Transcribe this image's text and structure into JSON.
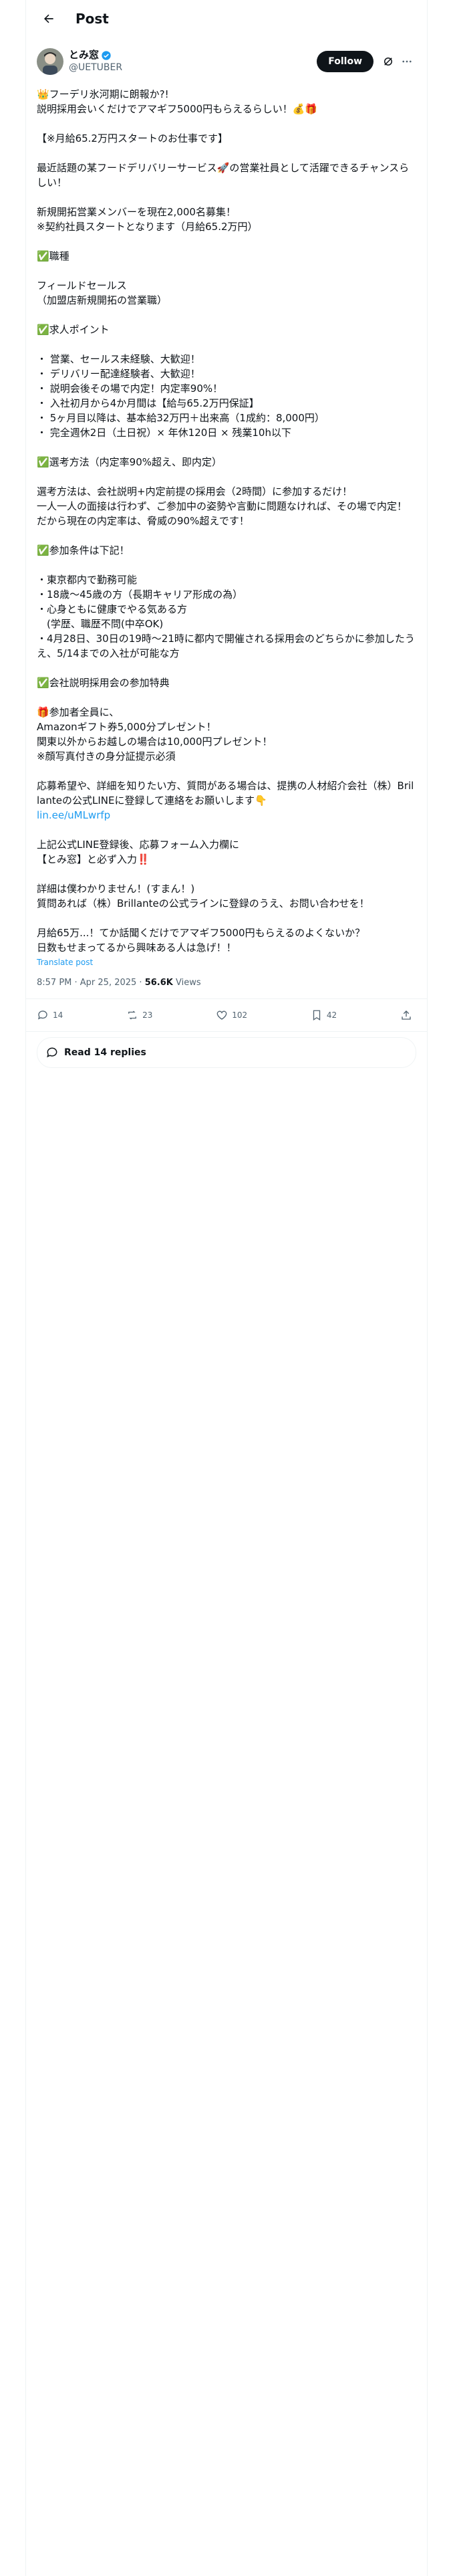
{
  "header": {
    "title": "Post"
  },
  "author": {
    "display_name": "とみ窓",
    "handle": "@UETUBER"
  },
  "buttons": {
    "follow": "Follow"
  },
  "post": {
    "text_1": "👑フーデリ氷河期に朗報か?!\n説明採用会いくだけでアマギフ5000円もらえるらしい！💰🎁\n\n【※月給65.2万円スタートのお仕事です】\n\n最近話題の某フードデリバリーサービス🚀の営業社員として活躍できるチャンスらしい！\n\n新規開拓営業メンバーを現在2,000名募集！\n※契約社員スタートとなります（月給65.2万円）\n\n✅職種\n\nフィールドセールス\n（加盟店新規開拓の営業職）\n\n✅求人ポイント\n\n・ 営業、セールス未経験、大歓迎！\n・ デリバリー配達経験者、大歓迎！\n・ 説明会後その場で内定！内定率90%！\n・ 入社初月から4か月間は【給与65.2万円保証】\n・ 5ヶ月目以降は、基本給32万円＋出来高（1成約：8,000円）\n・ 完全週休2日（土日祝）× 年休120日 × 残業10h以下\n\n✅選考方法（内定率90%超え、即内定）\n\n選考方法は、会社説明+内定前提の採用会（2時間）に参加するだけ！\n一人一人の面接は行わず、ご参加中の姿勢や言動に問題なければ、その場で内定！\nだから現在の内定率は、脅威の90%超えです！\n\n✅参加条件は下記！\n\n・東京都内で勤務可能\n・18歳〜45歳の方（長期キャリア形成の為）\n・心身ともに健康でやる気ある方\n　(学歴、職歴不問(中卒OK)\n・4月28日、30日の19時〜21時に都内で開催される採用会のどちらかに参加したうえ、5/14までの入社が可能な方\n\n✅会社説明採用会の参加特典\n\n🎁参加者全員に、\nAmazonギフト券5,000分プレゼント！\n関東以外からお越しの場合は10,000円プレゼント！\n※顔写真付きの身分証提示必須\n\n応募希望や、詳細を知りたい方、質問がある場合は、提携の人材紹介会社（株）Brillanteの公式LINEに登録して連絡をお願いします👇\n",
    "link": "lin.ee/uMLwrfp",
    "text_2": "\n\n上記公式LINE登録後、応募フォーム入力欄に\n【とみ窓】と必ず入力‼️\n\n詳細は僕わかりません！(すまん！)\n質問あれば（株）Brillanteの公式ラインに登録のうえ、お問い合わせを！\n\n月給65万...！てか話聞くだけでアマギフ5000円もらえるのよくないか？\n日数もせまってるから興味ある人は急げ！！"
  },
  "translate_label": "Translate post",
  "meta": {
    "time": "8:57 PM · Apr 25, 2025 · ",
    "views_count": "56.6K",
    "views_label": " Views"
  },
  "actions": {
    "replies": "14",
    "reposts": "23",
    "likes": "102",
    "bookmarks": "42"
  },
  "read_replies": "Read 14 replies"
}
